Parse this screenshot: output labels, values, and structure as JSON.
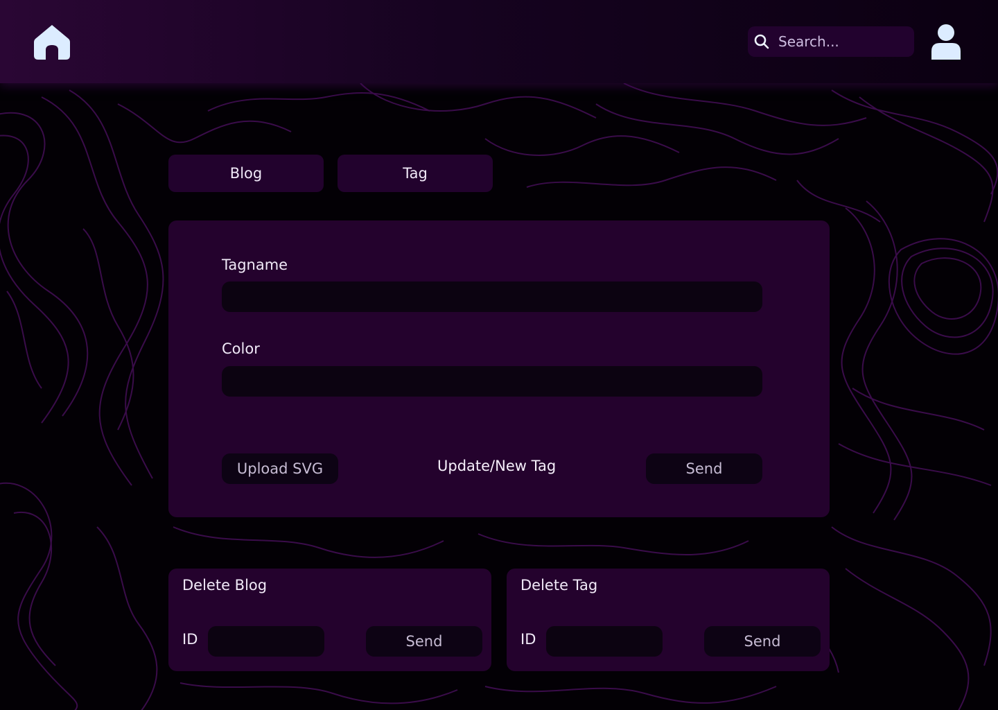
{
  "header": {
    "search_placeholder": "Search...",
    "home_icon": "home-icon",
    "user_icon": "user-icon"
  },
  "tabs": [
    {
      "label": "Blog"
    },
    {
      "label": "Tag"
    }
  ],
  "tag_form": {
    "tagname_label": "Tagname",
    "tagname_value": "",
    "color_label": "Color",
    "color_value": "",
    "upload_label": "Upload SVG",
    "mode_label": "Update/New Tag",
    "send_label": "Send"
  },
  "delete_blog": {
    "title": "Delete Blog",
    "id_label": "ID",
    "id_value": "",
    "send_label": "Send"
  },
  "delete_tag": {
    "title": "Delete Tag",
    "id_label": "ID",
    "id_value": "",
    "send_label": "Send"
  },
  "colors": {
    "background": "#030005",
    "panel": "#24022d",
    "input": "#0c0311",
    "icon": "#dcecff",
    "contour": "#3a0c4a"
  }
}
